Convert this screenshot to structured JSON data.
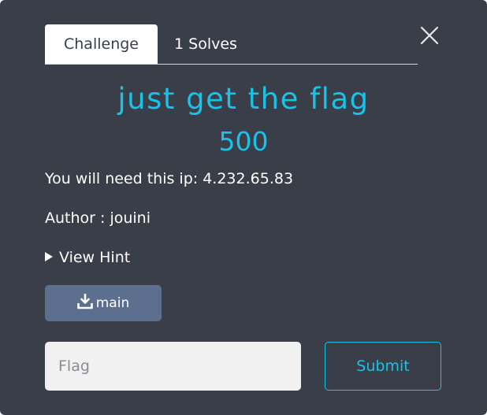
{
  "tabs": [
    {
      "label": "Challenge",
      "active": true
    },
    {
      "label": "1 Solves",
      "active": false
    }
  ],
  "challenge": {
    "name": "just get the flag",
    "value": "500",
    "description_lines": [
      "You will need this ip: 4.232.65.83",
      "Author : jouini"
    ],
    "hint_label": "View Hint",
    "file_label": "main"
  },
  "submission": {
    "placeholder": "Flag",
    "value": "",
    "submit_label": "Submit"
  },
  "icons": {
    "close": "close-icon",
    "hint": "triangle-right-icon",
    "file": "download-icon"
  },
  "colors": {
    "background": "#3a3e48",
    "accent": "#19c2e6",
    "file_button": "#5c6f8e",
    "input_background": "#f1f1f1",
    "active_tab": "#ffffff"
  }
}
